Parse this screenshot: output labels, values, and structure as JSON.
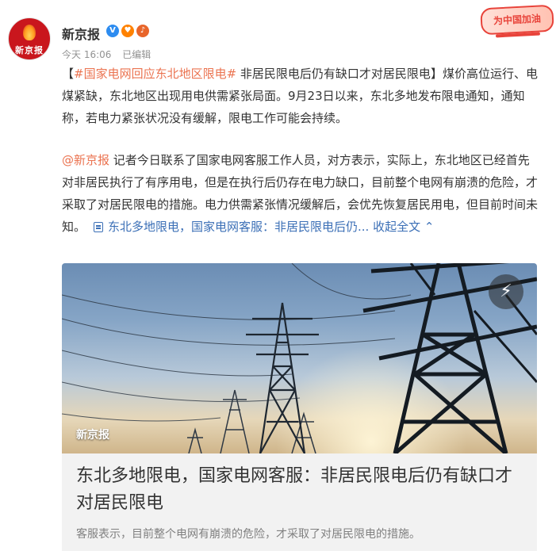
{
  "author": {
    "name": "新京报",
    "avatar_text": "新京报",
    "badges": [
      "verified-icon",
      "medal-icon",
      "guitar-icon"
    ]
  },
  "meta": {
    "time": "今天 16:06",
    "edited": "已编辑"
  },
  "cheer_badge": "为中国加油",
  "post": {
    "bracket_open": "【",
    "topic": "#国家电网回应东北地区限电#",
    "headline_rest": " 非居民限电后仍有缺口才对居民限电",
    "bracket_close": "】",
    "body1": "煤价高位运行、电煤紧缺，东北地区出现用电供需紧张局面。9月23日以来，东北多地发布限电通知，通知称，若电力紧张状况没有缓解，限电工作可能会持续。",
    "mention": "@新京报",
    "body2": " 记者今日联系了国家电网客服工作人员，对方表示，实际上，东北地区已经首先对非居民执行了有序用电，但是在执行后仍存在电力缺口，目前整个电网有崩溃的危险，才采取了对居民限电的措施。电力供需紧张情况缓解后，会优先恢复居民用电，但目前时间未知。",
    "article_link": "东北多地限电，国家电网客服：非居民限电后仍...",
    "collapse": "收起全文"
  },
  "card": {
    "source_label": "新京报",
    "title": "东北多地限电，国家电网客服：非居民限电后仍有缺口才对居民限电",
    "description": "客服表示，目前整个电网有崩溃的危险，才采取了对居民限电的措施。",
    "icon": "lightning-icon"
  },
  "colors": {
    "link": "#eb7350",
    "article_link": "#3b6fb6",
    "meta": "#939393",
    "card_bg": "#f2f2f2"
  }
}
